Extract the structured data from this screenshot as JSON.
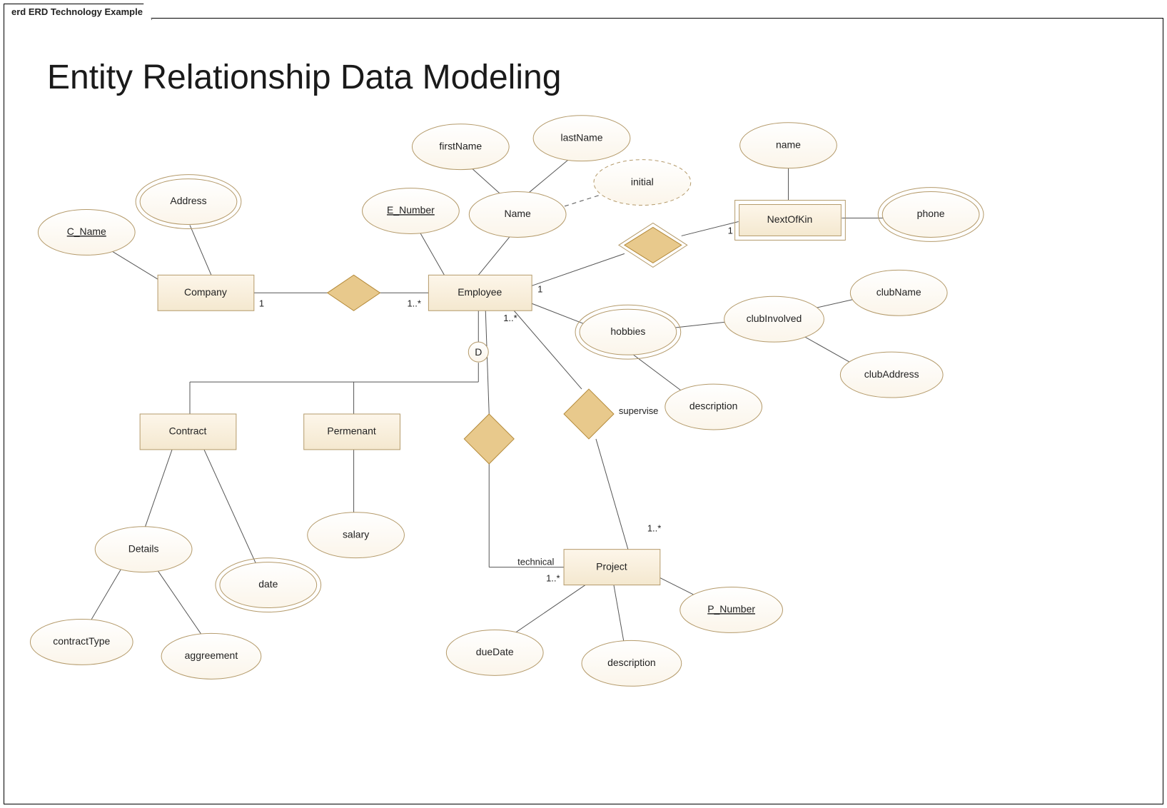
{
  "tabLabel": "erd ERD Technology Example",
  "title": "Entity Relationship Data Modeling",
  "entities": {
    "company": "Company",
    "employee": "Employee",
    "nextOfKin": "NextOfKin",
    "contract": "Contract",
    "permenant": "Permenant",
    "project": "Project"
  },
  "attributes": {
    "cName": "C_Name",
    "address": "Address",
    "eNumber": "E_Number",
    "name": "Name",
    "firstName": "firstName",
    "lastName": "lastName",
    "initial": "initial",
    "nokName": "name",
    "phone": "phone",
    "hobbies": "hobbies",
    "clubInvolved": "clubInvolved",
    "clubName": "clubName",
    "clubAddress": "clubAddress",
    "hobbyDescription": "description",
    "details": "Details",
    "contractType": "contractType",
    "aggreement": "aggreement",
    "date": "date",
    "salary": "salary",
    "dueDate": "dueDate",
    "projDescription": "description",
    "pNumber": "P_Number"
  },
  "relationships": {
    "supervise": "supervise",
    "technical": "technical"
  },
  "cardinalities": {
    "company_emp": "1",
    "emp_company": "1..*",
    "emp_nok": "1",
    "nok_emp": "1",
    "emp_proj_tech_from": "1..*",
    "proj_tech_to": "1..*",
    "proj_supervise_to": "1..*"
  },
  "discriminator": "D"
}
